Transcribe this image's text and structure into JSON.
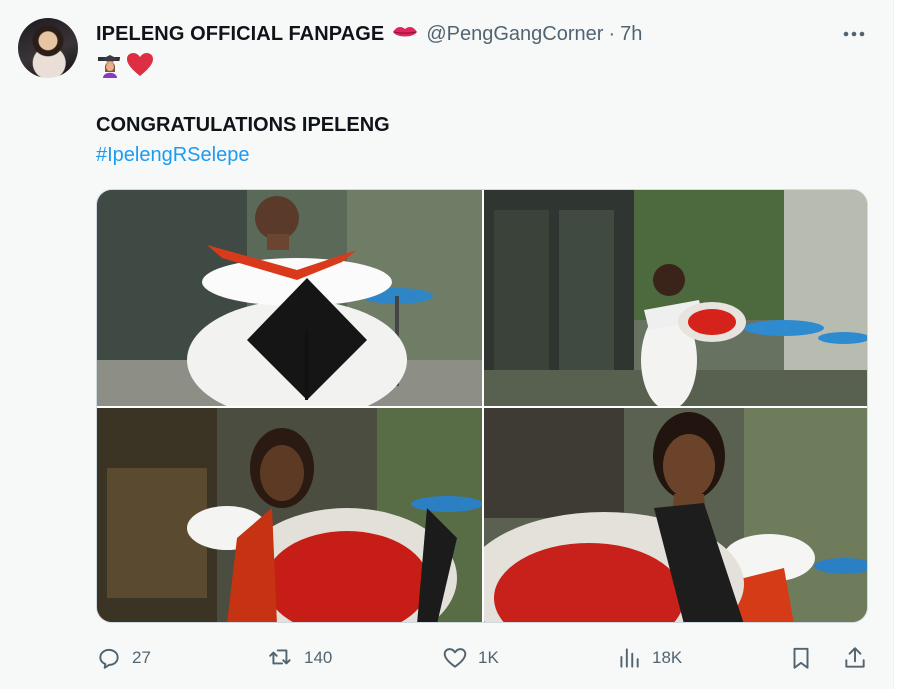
{
  "tweet": {
    "display_name": "IPELENG OFFICIAL FANPAGE",
    "name_emoji": "lips-icon",
    "handle": "@PengGangCorner",
    "separator": "·",
    "time": "7h",
    "emojis": [
      "graduate-icon",
      "red-heart-icon"
    ],
    "text_line1": "CONGRATULATIONS IPELENG",
    "hashtag": "#IpelengRSelepe",
    "photos": [
      {
        "alt": "Graduate in white off-shoulder dress holding mortarboard"
      },
      {
        "alt": "Graduate holding red rose bouquet in front of building"
      },
      {
        "alt": "Graduate smiling with large red rose bouquet"
      },
      {
        "alt": "Graduate close-up smiling with rose bouquet"
      }
    ]
  },
  "actions": {
    "reply_count": "27",
    "retweet_count": "140",
    "like_count": "1K",
    "views_count": "18K"
  },
  "colors": {
    "background": "#f7f9f9",
    "text": "#0f1419",
    "muted": "#536471",
    "link": "#1d9bf0"
  }
}
